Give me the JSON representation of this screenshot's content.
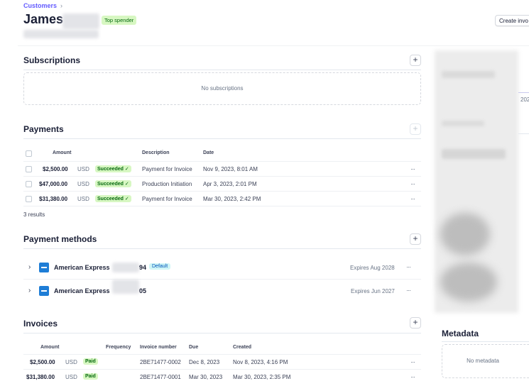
{
  "breadcrumb": {
    "label": "Customers",
    "separator": "›"
  },
  "customer": {
    "name": "James",
    "badge": "Top spender"
  },
  "header": {
    "create_button": "Create invo"
  },
  "subscriptions": {
    "title": "Subscriptions",
    "add": "+",
    "empty": "No subscriptions"
  },
  "payments": {
    "title": "Payments",
    "add": "+",
    "headers": {
      "amount": "Amount",
      "description": "Description",
      "date": "Date"
    },
    "rows": [
      {
        "amount": "$2,500.00",
        "currency": "USD",
        "status": "Succeeded ✓",
        "description": "Payment for Invoice",
        "date": "Nov 9, 2023, 8:01 AM",
        "more": "···"
      },
      {
        "amount": "$47,000.00",
        "currency": "USD",
        "status": "Succeeded ✓",
        "description": "Production Initiation",
        "date": "Apr 3, 2023, 2:01 PM",
        "more": "···"
      },
      {
        "amount": "$31,380.00",
        "currency": "USD",
        "status": "Succeeded ✓",
        "description": "Payment for Invoice",
        "date": "Mar 30, 2023, 2:42 PM",
        "more": "···"
      }
    ],
    "results": "3 results"
  },
  "payment_methods": {
    "title": "Payment methods",
    "add": "+",
    "items": [
      {
        "brand": "American Express",
        "last4_visible": "94",
        "badge": "Default",
        "expires": "Expires Aug 2028",
        "more": "···",
        "chevron": "›"
      },
      {
        "brand": "American Express",
        "last4_visible": "05",
        "badge": "",
        "expires": "Expires Jun 2027",
        "more": "···",
        "chevron": "›"
      }
    ]
  },
  "invoices": {
    "title": "Invoices",
    "add": "+",
    "headers": {
      "amount": "Amount",
      "frequency": "Frequency",
      "number": "Invoice number",
      "due": "Due",
      "created": "Created"
    },
    "rows": [
      {
        "amount": "$2,500.00",
        "currency": "USD",
        "status": "Paid",
        "number": "2BE71477-0002",
        "due": "Dec 8, 2023",
        "created": "Nov 8, 2023, 4:16 PM",
        "more": "···"
      },
      {
        "amount": "$31,380.00",
        "currency": "USD",
        "status": "Paid",
        "number": "2BE71477-0001",
        "due": "Mar 30, 2023",
        "created": "Mar 30, 2023, 2:35 PM",
        "more": "···"
      }
    ]
  },
  "side_panel": {
    "fragment": "202"
  },
  "metadata": {
    "title": "Metadata",
    "empty": "No metadata"
  }
}
